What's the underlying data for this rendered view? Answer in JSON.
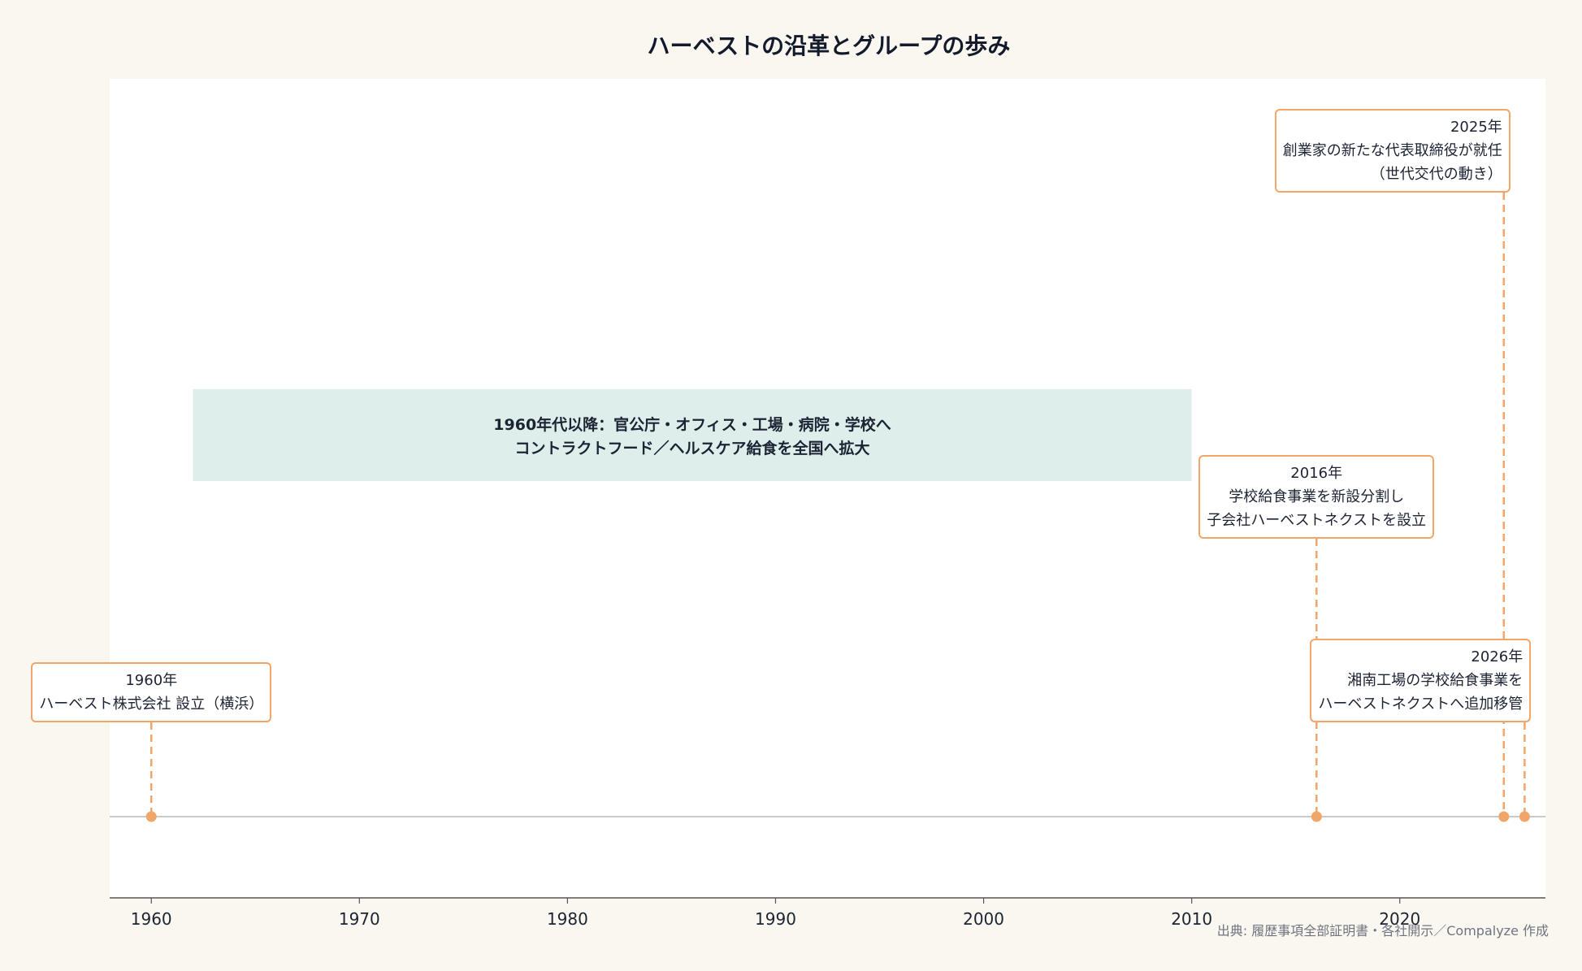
{
  "chart_data": {
    "type": "timeline",
    "title": "ハーベストの沿革とグループの歩み",
    "xlim": [
      1958,
      2027
    ],
    "x_ticks": [
      1960,
      1970,
      1980,
      1990,
      2000,
      2010,
      2020
    ],
    "x_tick_labels": [
      "1960",
      "1970",
      "1980",
      "1990",
      "2000",
      "2010",
      "2020"
    ],
    "band": {
      "start": 1962,
      "end": 2010,
      "lines": [
        "1960年代以降：官公庁・オフィス・工場・病院・学校へ",
        "コントラクトフード／ヘルスケア給食を全国へ拡大"
      ]
    },
    "events": [
      {
        "year": 1960,
        "align": "center",
        "lines": [
          "1960年",
          "ハーベスト株式会社 設立（横浜）"
        ]
      },
      {
        "year": 2016,
        "align": "center",
        "lines": [
          "2016年",
          "学校給食事業を新設分割し",
          "子会社ハーベストネクストを設立"
        ]
      },
      {
        "year": 2025,
        "align": "right",
        "lines": [
          "2025年",
          "創業家の新たな代表取締役が就任",
          "（世代交代の動き）"
        ]
      },
      {
        "year": 2026,
        "align": "right",
        "lines": [
          "2026年",
          "湘南工場の学校給食事業を",
          "ハーベストネクストへ追加移管"
        ]
      }
    ],
    "source": "出典: 履歴事項全部証明書・各社開示／Compalyze 作成",
    "colors": {
      "accent": "#f2a569",
      "band": "#ddeeeb",
      "axis": "#555555",
      "baseline": "#b8b8b8"
    }
  }
}
